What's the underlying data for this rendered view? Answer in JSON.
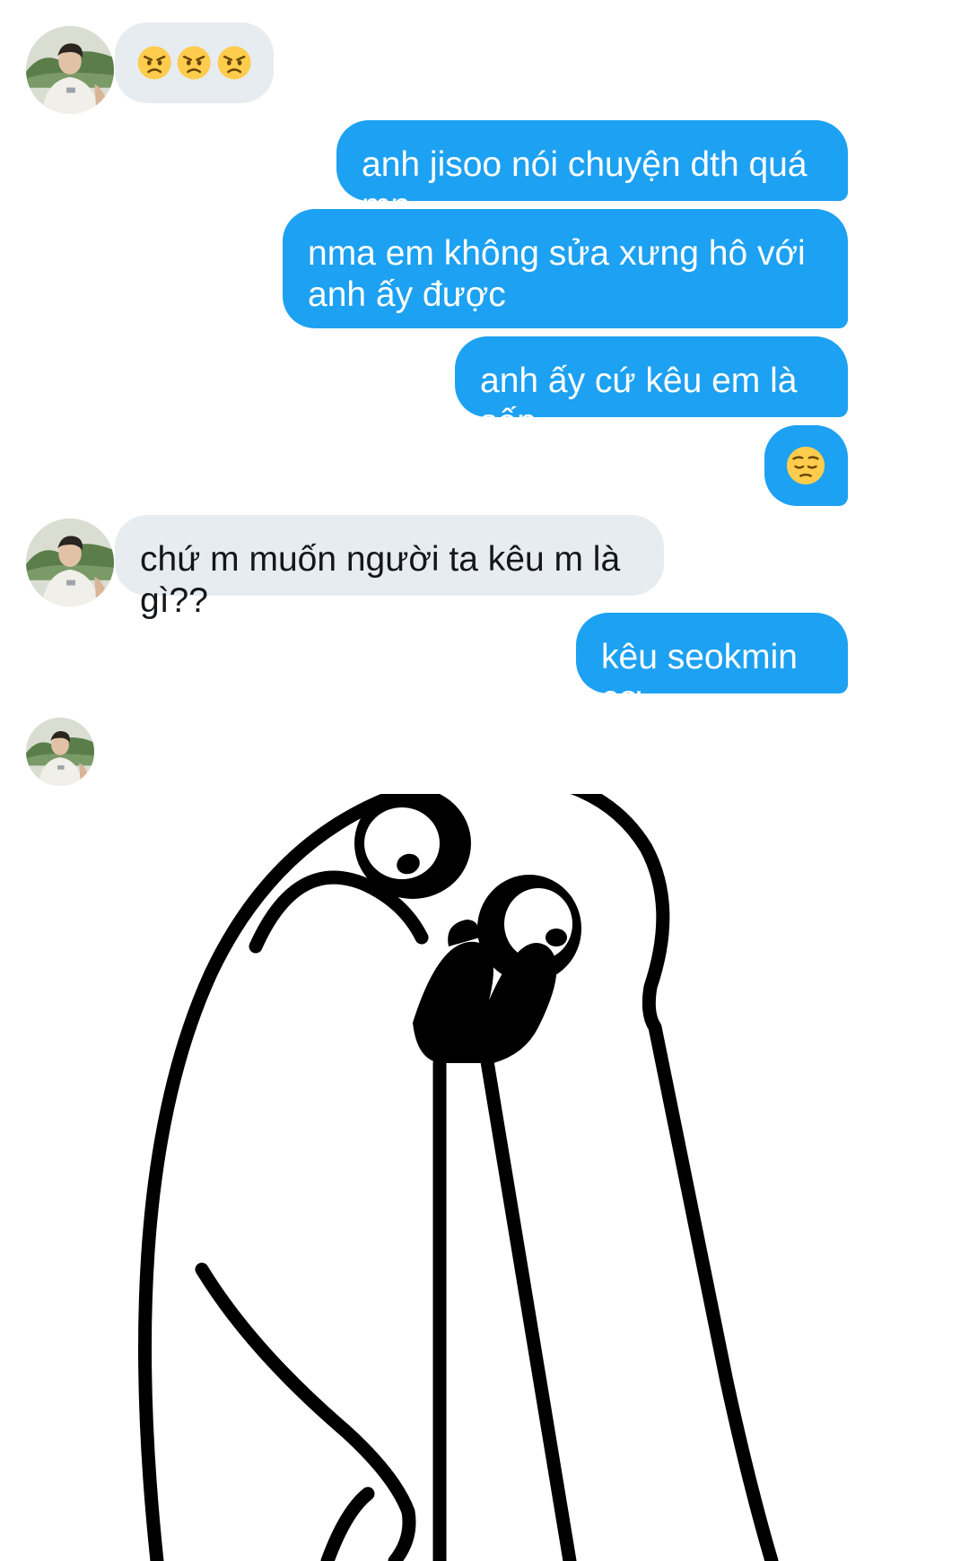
{
  "conversation": {
    "messages": [
      {
        "sender": "them",
        "kind": "emoji",
        "emojis": [
          "angry-face",
          "angry-face",
          "angry-face"
        ]
      },
      {
        "sender": "me",
        "text": "anh jisoo nói chuyện dth quá mn"
      },
      {
        "sender": "me",
        "text": "nma em không sửa xưng hô với anh ấy được"
      },
      {
        "sender": "me",
        "text": "anh ấy cứ kêu em là sếp"
      },
      {
        "sender": "me",
        "kind": "emoji",
        "emojis": [
          "pensive-face"
        ]
      },
      {
        "sender": "them",
        "text": "chứ m muốn người ta kêu m là gì??"
      },
      {
        "sender": "me",
        "text": "kêu seokmin cơ"
      },
      {
        "sender": "them",
        "kind": "sticker",
        "sticker": "meme-face-sticker"
      }
    ]
  },
  "colors": {
    "outgoing_bubble": "#1da1f2",
    "incoming_bubble": "#e6ecf0",
    "incoming_text": "#14171a",
    "outgoing_text": "#ffffff"
  },
  "icons": [
    "avatar",
    "angry-face",
    "pensive-face",
    "meme-face-sticker"
  ]
}
